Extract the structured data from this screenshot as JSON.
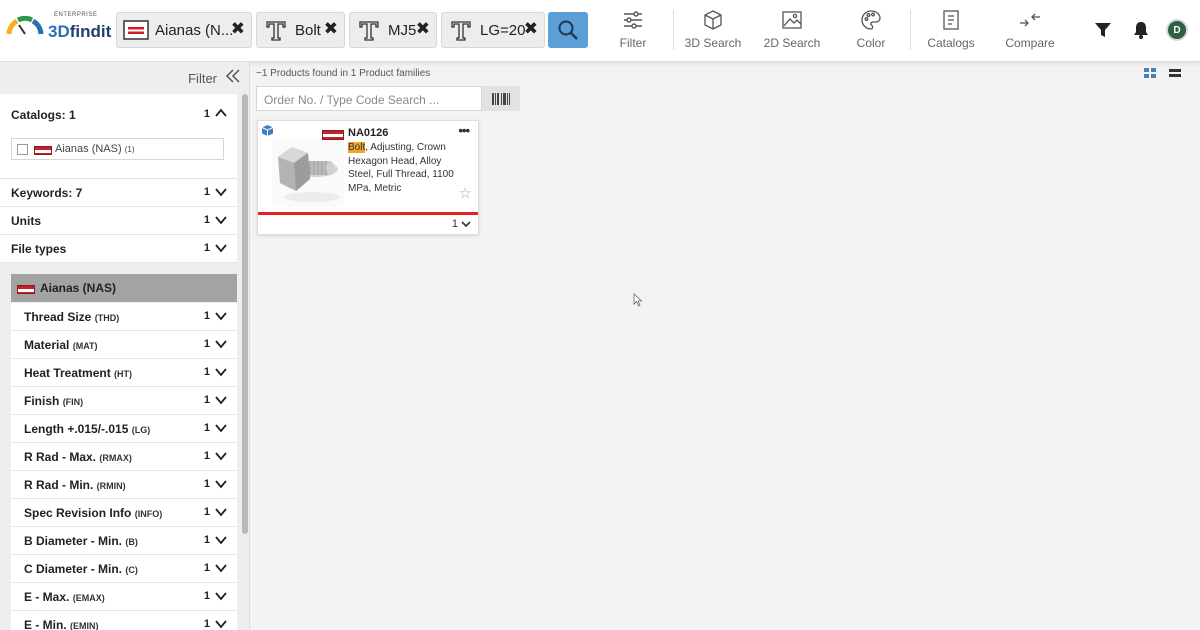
{
  "header": {
    "logo": {
      "small": "ENTERPRISE",
      "main_a": "3D",
      "main_b": "findit"
    },
    "chips": [
      {
        "label": "Aianas (N...",
        "icon": "catalog-icon"
      },
      {
        "label": "Bolt",
        "icon": "text-icon"
      },
      {
        "label": "MJ5",
        "icon": "text-icon"
      },
      {
        "label": "LG=20",
        "icon": "text-icon"
      }
    ],
    "chip_close": "✖",
    "tools": [
      {
        "label": "Filter",
        "icon": "sliders-icon"
      },
      {
        "label": "3D Search",
        "icon": "cube-icon"
      },
      {
        "label": "2D Search",
        "icon": "image-icon"
      },
      {
        "label": "Color",
        "icon": "palette-icon"
      },
      {
        "label": "Catalogs",
        "icon": "catalog-book-icon"
      },
      {
        "label": "Compare",
        "icon": "compare-icon"
      }
    ],
    "avatar_text": "D"
  },
  "sidebar": {
    "filter_label": "Filter",
    "sections": [
      {
        "label": "Catalogs: 1",
        "count": "1"
      },
      {
        "label": "Keywords: 7",
        "count": "1"
      },
      {
        "label": "Units",
        "count": "1"
      },
      {
        "label": "File types",
        "count": "1"
      }
    ],
    "catalog_option": {
      "label": "Aianas (NAS)",
      "count": "(1)"
    },
    "manufacturer": "Aianas (NAS)",
    "attributes": [
      {
        "name": "Thread Size",
        "code": "(THD)",
        "count": "1"
      },
      {
        "name": "Material",
        "code": "(MAT)",
        "count": "1"
      },
      {
        "name": "Heat Treatment",
        "code": "(HT)",
        "count": "1"
      },
      {
        "name": "Finish",
        "code": "(FIN)",
        "count": "1"
      },
      {
        "name": "Length +.015/-.015",
        "code": "(LG)",
        "count": "1"
      },
      {
        "name": "R Rad - Max.",
        "code": "(RMAX)",
        "count": "1"
      },
      {
        "name": "R Rad - Min.",
        "code": "(RMIN)",
        "count": "1"
      },
      {
        "name": "Spec Revision Info",
        "code": "(INFO)",
        "count": "1"
      },
      {
        "name": "B Diameter - Min.",
        "code": "(B)",
        "count": "1"
      },
      {
        "name": "C Diameter - Min.",
        "code": "(C)",
        "count": "1"
      },
      {
        "name": "E - Max.",
        "code": "(EMAX)",
        "count": "1"
      },
      {
        "name": "E - Min.",
        "code": "(EMIN)",
        "count": "1"
      }
    ]
  },
  "main": {
    "result_text": "~1 Products found in 1 Product families",
    "order_placeholder": "Order No. / Type Code Search ...",
    "card": {
      "part_number": "NA0126",
      "highlight": "Bolt",
      "desc_rest": ", Adjusting, Crown Hexagon Head, Alloy Steel, Full Thread, 1100 MPa, Metric",
      "more": "•••",
      "star": "☆",
      "qty": "1"
    }
  },
  "colors": {
    "accent": "#5c9ed6",
    "highlight": "#f3a42b",
    "card_bar": "#e2201c",
    "brand_red": "#c8202a"
  }
}
